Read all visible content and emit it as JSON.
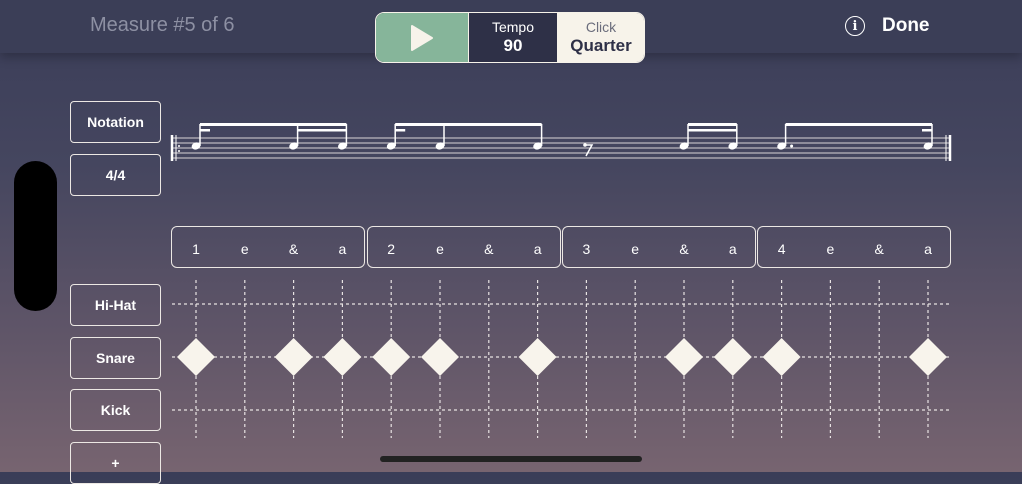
{
  "header": {
    "measure_label": "Measure #5 of 6",
    "tempo_label": "Tempo",
    "tempo_value": "90",
    "click_label": "Click",
    "click_value": "Quarter",
    "done_label": "Done",
    "info_glyph": "i"
  },
  "sidebar": {
    "notation_label": "Notation",
    "time_signature_label": "4/4",
    "add_label": "+"
  },
  "tracks": [
    {
      "name": "Hi-Hat",
      "hits": []
    },
    {
      "name": "Snare",
      "hits": [
        0,
        2,
        3,
        4,
        5,
        7,
        10,
        11,
        12,
        15
      ]
    },
    {
      "name": "Kick",
      "hits": []
    }
  ],
  "counts": [
    "1",
    "e",
    "&",
    "a",
    "2",
    "e",
    "&",
    "a",
    "3",
    "e",
    "&",
    "a",
    "4",
    "e",
    "&",
    "a"
  ],
  "colors": {
    "accent_green": "#86b59a",
    "ink": "#f7f3ea",
    "panel_dark": "#2e3047"
  },
  "icons": {
    "play": "play-icon",
    "info": "info-icon",
    "rest": "eighth-rest-icon"
  }
}
